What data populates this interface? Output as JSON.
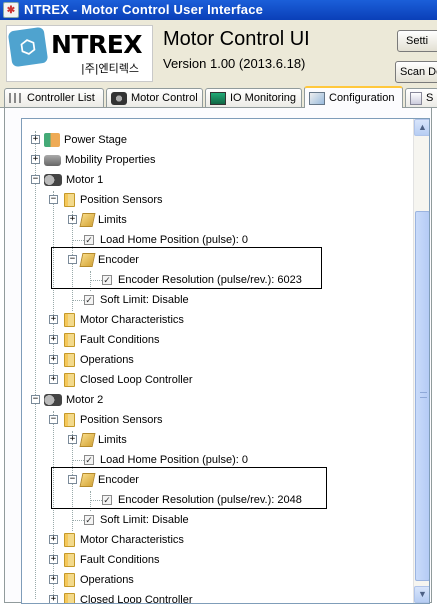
{
  "window": {
    "title": "NTREX - Motor Control User Interface",
    "icon": "app-icon"
  },
  "header": {
    "logo_brand": "NTREX",
    "logo_sub": "|주|엔티렉스",
    "app_title": "Motor Control UI",
    "app_version": "Version 1.00 (2013.6.18)",
    "settings_button": "Setti",
    "scan_button": "Scan De"
  },
  "tabs": [
    {
      "label": "Controller List",
      "icon": "list-icon",
      "active": false
    },
    {
      "label": "Motor Control",
      "icon": "motor-control-icon",
      "active": false
    },
    {
      "label": "IO Monitoring",
      "icon": "monitor-icon",
      "active": false
    },
    {
      "label": "Configuration",
      "icon": "configuration-icon",
      "active": true
    },
    {
      "label": "S",
      "icon": "script-icon",
      "active": false
    }
  ],
  "tree": {
    "power_stage": "Power Stage",
    "mobility_properties": "Mobility Properties",
    "motor1": {
      "label": "Motor 1",
      "position_sensors": "Position Sensors",
      "limits": "Limits",
      "load_home": "Load Home Position (pulse): 0",
      "encoder": "Encoder",
      "encoder_resolution": "Encoder Resolution (pulse/rev.): 6023",
      "soft_limit": "Soft Limit: Disable",
      "motor_characteristics": "Motor Characteristics",
      "fault_conditions": "Fault Conditions",
      "operations": "Operations",
      "closed_loop": "Closed Loop Controller"
    },
    "motor2": {
      "label": "Motor 2",
      "position_sensors": "Position Sensors",
      "limits": "Limits",
      "load_home": "Load Home Position (pulse): 0",
      "encoder": "Encoder",
      "encoder_resolution": "Encoder Resolution (pulse/rev.): 2048",
      "soft_limit": "Soft Limit: Disable",
      "motor_characteristics": "Motor Characteristics",
      "fault_conditions": "Fault Conditions",
      "operations": "Operations",
      "closed_loop": "Closed Loop Controller"
    }
  }
}
